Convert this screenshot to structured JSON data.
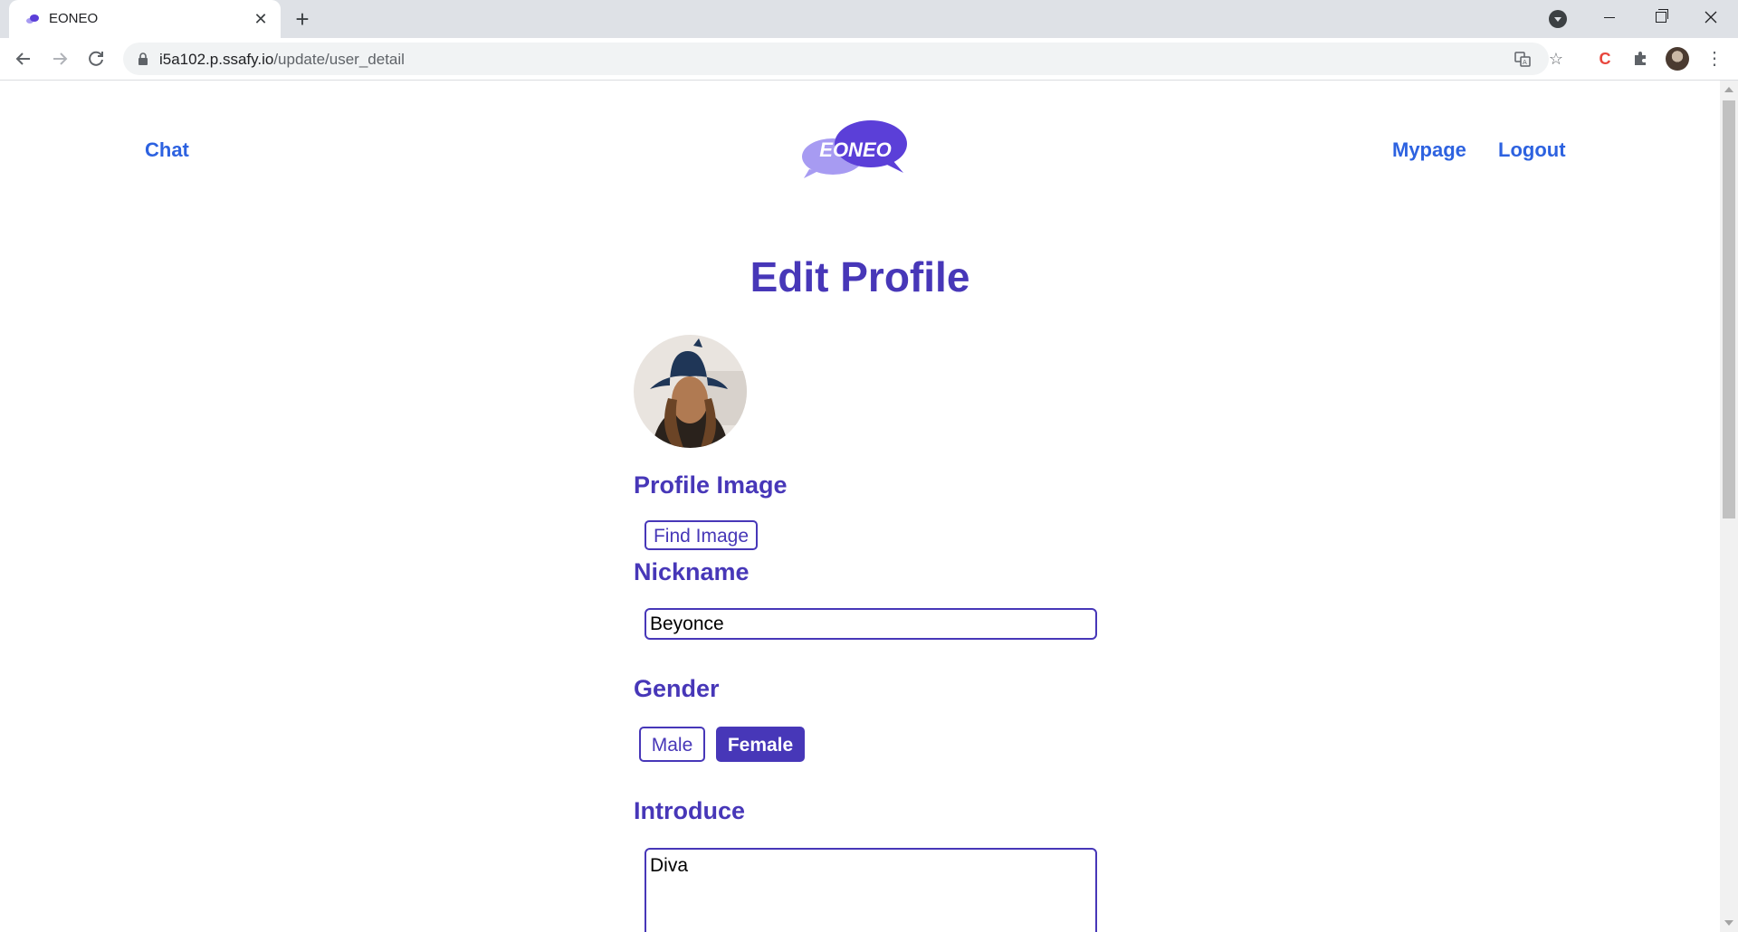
{
  "browser": {
    "tab_title": "EONEO",
    "url_host": "i5a102.p.ssafy.io",
    "url_path": "/update/user_detail"
  },
  "site": {
    "nav": {
      "chat": "Chat",
      "mypage": "Mypage",
      "logout": "Logout"
    },
    "logo_text": "EONEO"
  },
  "form": {
    "title": "Edit Profile",
    "profile_image_label": "Profile Image",
    "find_image_button": "Find Image",
    "nickname_label": "Nickname",
    "nickname_value": "Beyonce",
    "gender_label": "Gender",
    "gender_options": [
      "Male",
      "Female"
    ],
    "gender_selected": "Female",
    "introduce_label": "Introduce",
    "introduce_value": "Diva"
  },
  "colors": {
    "brand_purple": "#4737b8",
    "nav_link_blue": "#2d62e0",
    "logo_light_purple": "#a79bf2",
    "logo_dark_purple": "#5b3fd8"
  },
  "icons": [
    "close-icon",
    "plus-icon",
    "back-arrow-icon",
    "forward-arrow-icon",
    "reload-icon",
    "lock-icon",
    "translate-icon",
    "star-icon",
    "puzzle-icon",
    "kebab-menu-icon"
  ]
}
